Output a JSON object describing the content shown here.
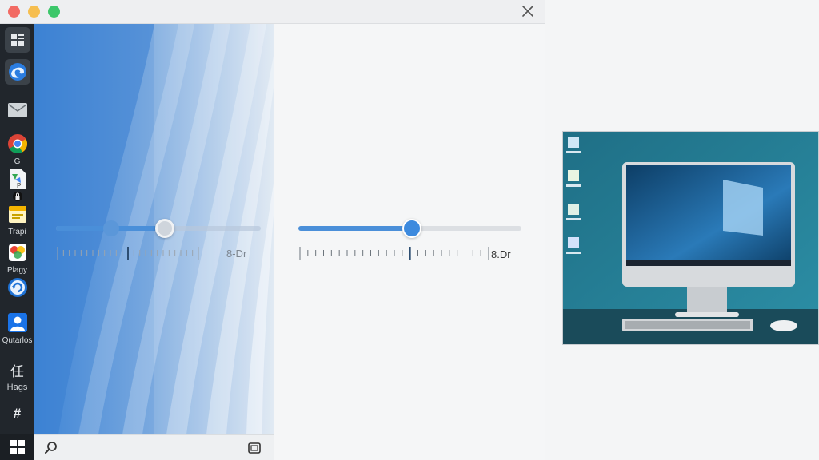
{
  "window": {
    "traffic_lights": {
      "close": "#f26a63",
      "minimize": "#f6be4f",
      "maximize": "#3cc76a"
    }
  },
  "sidebar": {
    "items": [
      {
        "name": "grid-app-icon",
        "label": ""
      },
      {
        "name": "edge-browser-icon",
        "label": ""
      },
      {
        "name": "mail-icon",
        "label": ""
      },
      {
        "name": "chrome-icon",
        "label": "G"
      },
      {
        "name": "document-icon",
        "label": ""
      },
      {
        "name": "notes-icon",
        "label": "Trapi"
      },
      {
        "name": "photos-icon",
        "label": "Plagy"
      },
      {
        "name": "refresh-app-icon",
        "label": ""
      },
      {
        "name": "contacts-icon",
        "label": "Qutarlos"
      },
      {
        "name": "kanji-app-icon",
        "label": "Hags",
        "glyph": "任"
      },
      {
        "name": "hashtag-icon",
        "label": "",
        "glyph": "#"
      }
    ]
  },
  "left_panel": {
    "slider": {
      "value_fraction": 0.53,
      "secondary_fraction": 0.27
    },
    "readout": "8-Dr"
  },
  "right_panel": {
    "slider": {
      "value_fraction": 0.51
    },
    "readout": "8.Dr"
  },
  "colors": {
    "accent": "#4a8fd9",
    "panel_blue": "#3f85d6"
  }
}
